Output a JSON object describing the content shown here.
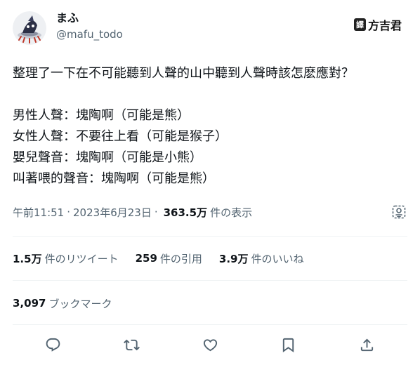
{
  "author": {
    "display_name": "まふ",
    "handle": "@mafu_todo"
  },
  "watermark": {
    "box": "譯",
    "text": "方吉君"
  },
  "tweet": {
    "text": "整理了一下在不可能聽到人聲的山中聽到人聲時該怎麽應對？\n\n男性人聲：塊陶啊（可能是熊）\n女性人聲：不要往上看（可能是猴子）\n嬰兒聲音：塊陶啊（可能是小熊）\n叫著喂的聲音：塊陶啊（可能是熊）"
  },
  "meta": {
    "time": "午前11:51",
    "separator1": "·",
    "date": "2023年6月23日",
    "separator2": "·",
    "views_count": "363.5万",
    "views_label": "件の表示"
  },
  "stats": {
    "retweets_count": "1.5万",
    "retweets_label": "件のリツイート",
    "quotes_count": "259",
    "quotes_label": "件の引用",
    "likes_count": "3.9万",
    "likes_label": "件のいいね"
  },
  "bookmarks": {
    "count": "3,097",
    "label": "ブックマーク"
  },
  "icons": {
    "reply": "reply-icon",
    "retweet": "retweet-icon",
    "like": "heart-icon",
    "bookmark": "bookmark-icon",
    "share": "share-icon",
    "analytics": "analytics-icon"
  },
  "colors": {
    "text_primary": "#0f1419",
    "text_secondary": "#536471",
    "divider": "#eff3f4"
  }
}
